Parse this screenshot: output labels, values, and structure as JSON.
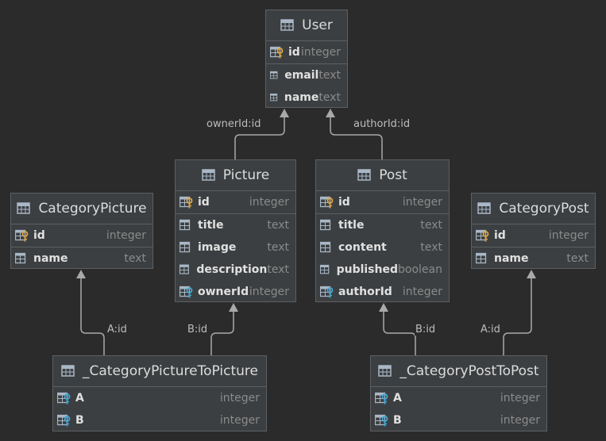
{
  "colors": {
    "background": "#2b2b2b",
    "entity_fill": "#3c3f41",
    "entity_border": "#5d6063",
    "edge": "#a9a9a9",
    "pk_key": "#e0a53c",
    "fk_key": "#3fa9d8",
    "table_icon": "#a9b7c6"
  },
  "entities": {
    "user": {
      "title": "User",
      "columns": [
        {
          "name": "id",
          "type": "integer",
          "icon": "primary-key-icon"
        },
        {
          "name": "email",
          "type": "text",
          "icon": "column-icon"
        },
        {
          "name": "name",
          "type": "text",
          "icon": "column-icon"
        }
      ]
    },
    "picture": {
      "title": "Picture",
      "columns": [
        {
          "name": "id",
          "type": "integer",
          "icon": "primary-key-icon"
        },
        {
          "name": "title",
          "type": "text",
          "icon": "column-icon"
        },
        {
          "name": "image",
          "type": "text",
          "icon": "column-icon"
        },
        {
          "name": "description",
          "type": "text",
          "icon": "column-icon"
        },
        {
          "name": "ownerId",
          "type": "integer",
          "icon": "foreign-key-icon"
        }
      ]
    },
    "post": {
      "title": "Post",
      "columns": [
        {
          "name": "id",
          "type": "integer",
          "icon": "primary-key-icon"
        },
        {
          "name": "title",
          "type": "text",
          "icon": "column-icon"
        },
        {
          "name": "content",
          "type": "text",
          "icon": "column-icon"
        },
        {
          "name": "published",
          "type": "boolean",
          "icon": "column-icon"
        },
        {
          "name": "authorId",
          "type": "integer",
          "icon": "foreign-key-icon"
        }
      ]
    },
    "category_picture": {
      "title": "CategoryPicture",
      "columns": [
        {
          "name": "id",
          "type": "integer",
          "icon": "primary-key-icon"
        },
        {
          "name": "name",
          "type": "text",
          "icon": "column-icon"
        }
      ]
    },
    "category_post": {
      "title": "CategoryPost",
      "columns": [
        {
          "name": "id",
          "type": "integer",
          "icon": "primary-key-icon"
        },
        {
          "name": "name",
          "type": "text",
          "icon": "column-icon"
        }
      ]
    },
    "category_picture_to_picture": {
      "title": "_CategoryPictureToPicture",
      "columns": [
        {
          "name": "A",
          "type": "integer",
          "icon": "foreign-key-icon"
        },
        {
          "name": "B",
          "type": "integer",
          "icon": "foreign-key-icon"
        }
      ]
    },
    "category_post_to_post": {
      "title": "_CategoryPostToPost",
      "columns": [
        {
          "name": "A",
          "type": "integer",
          "icon": "foreign-key-icon"
        },
        {
          "name": "B",
          "type": "integer",
          "icon": "foreign-key-icon"
        }
      ]
    }
  },
  "relations": [
    {
      "label": "ownerId:id",
      "from": "picture",
      "to": "user"
    },
    {
      "label": "authorId:id",
      "from": "post",
      "to": "user"
    },
    {
      "label": "A:id",
      "from": "category_picture_to_picture",
      "to": "category_picture"
    },
    {
      "label": "B:id",
      "from": "category_picture_to_picture",
      "to": "picture"
    },
    {
      "label": "B:id",
      "from": "category_post_to_post",
      "to": "post"
    },
    {
      "label": "A:id",
      "from": "category_post_to_post",
      "to": "category_post"
    }
  ]
}
